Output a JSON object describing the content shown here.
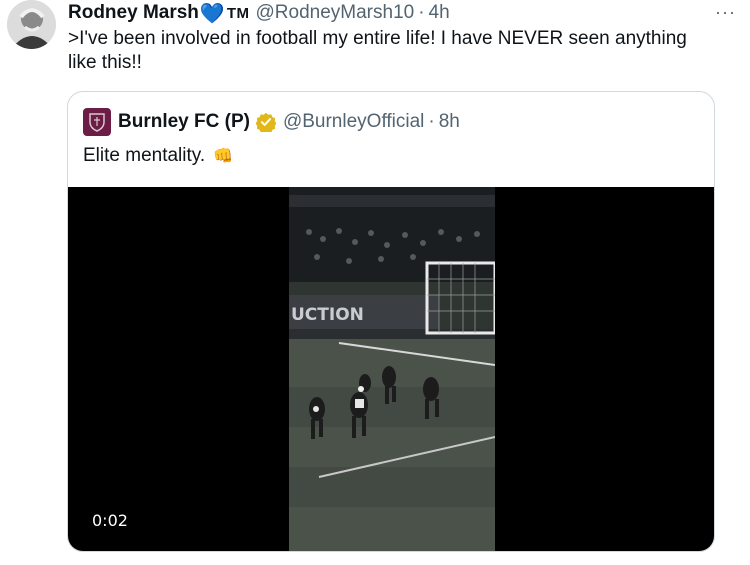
{
  "tweet": {
    "author_name": "Rodney Marsh",
    "heart_glyph": "💙",
    "tm": "TM",
    "handle": "@RodneyMarsh10",
    "separator": "·",
    "time": "4h",
    "more_glyph": "···",
    "text": ">I've been involved in football my entire life! I have NEVER seen anything like this!!"
  },
  "quote": {
    "author_name": "Burnley FC (P)",
    "handle": "@BurnleyOfficial",
    "separator": "·",
    "time": "8h",
    "text": "Elite mentality.",
    "emoji": "👊",
    "video": {
      "timestamp": "0:02",
      "board_text": "UCTION"
    }
  },
  "colors": {
    "text": "#0f1419",
    "muted": "#536471",
    "border": "#cfd9de",
    "heart": "#3b8ef0",
    "verified_gold": "#e2b719",
    "burnley_claret": "#6c1d45"
  }
}
